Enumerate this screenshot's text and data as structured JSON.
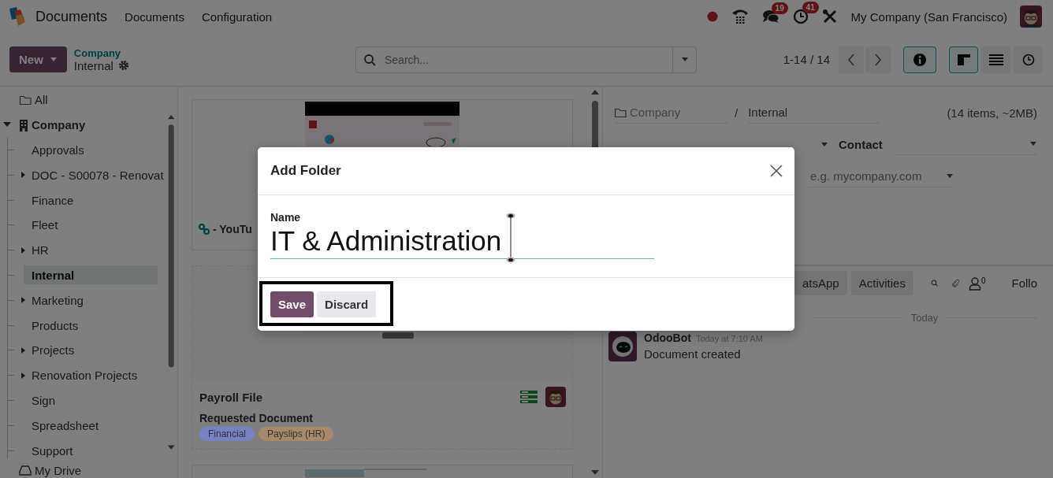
{
  "navbar": {
    "app_name": "Documents",
    "menu": [
      {
        "label": "Documents"
      },
      {
        "label": "Configuration"
      }
    ],
    "systray": [
      {
        "kind": "recording-dot"
      },
      {
        "kind": "phone"
      },
      {
        "kind": "chat",
        "badge": "19"
      },
      {
        "kind": "activity",
        "badge": "41"
      },
      {
        "kind": "tools"
      }
    ],
    "company": "My Company (San Francisco)"
  },
  "control_panel": {
    "new_button": "New",
    "breadcrumb": {
      "parent": "Company",
      "current": "Internal"
    },
    "search": {
      "placeholder": "Search..."
    },
    "pager": "1-14 / 14",
    "info_button": {
      "selected": true
    },
    "views": [
      {
        "kind": "kanban",
        "selected": true
      },
      {
        "kind": "list",
        "selected": false
      },
      {
        "kind": "activity",
        "selected": false
      }
    ]
  },
  "sidebar": {
    "items": [
      {
        "label": "All",
        "kind": "all",
        "selected": false
      },
      {
        "label": "Company",
        "kind": "company",
        "selected": false,
        "expanded": true,
        "children": [
          {
            "label": "Approvals",
            "expandable": false,
            "selected": false
          },
          {
            "label": "DOC - S00078 - Renovat",
            "expandable": true,
            "selected": false
          },
          {
            "label": "Finance",
            "expandable": false,
            "selected": false
          },
          {
            "label": "Fleet",
            "expandable": false,
            "selected": false
          },
          {
            "label": "HR",
            "expandable": true,
            "selected": false
          },
          {
            "label": "Internal",
            "expandable": false,
            "selected": true
          },
          {
            "label": "Marketing",
            "expandable": true,
            "selected": false
          },
          {
            "label": "Products",
            "expandable": false,
            "selected": false
          },
          {
            "label": "Projects",
            "expandable": true,
            "selected": false
          },
          {
            "label": "Renovation Projects",
            "expandable": true,
            "selected": false
          },
          {
            "label": "Sign",
            "expandable": false,
            "selected": false
          },
          {
            "label": "Spreadsheet",
            "expandable": false,
            "selected": false
          },
          {
            "label": "Support",
            "expandable": false,
            "selected": false
          }
        ]
      },
      {
        "label": "My Drive",
        "kind": "drive",
        "selected": false
      }
    ]
  },
  "kanban": {
    "cards": [
      {
        "kind": "link",
        "title": "- YouTu"
      },
      {
        "kind": "request",
        "title": "Payroll File",
        "subtitle": "Requested Document",
        "tags": [
          {
            "label": "Financial",
            "color": "#7582c4"
          },
          {
            "label": "Payslips (HR)",
            "color": "#a88a6a"
          }
        ]
      },
      {
        "kind": "sheet"
      }
    ]
  },
  "details": {
    "folder_path": {
      "parent": "Company",
      "separator": "/",
      "current": "Internal"
    },
    "summary": "(14 items, ~2MB)",
    "contact_label": "Contact",
    "domain": {
      "placeholder": "e.g. mycompany.com"
    },
    "chatter": {
      "buttons": [
        {
          "label": "atsApp"
        },
        {
          "label": "Activities"
        }
      ],
      "followers_count": "0",
      "follow_label": "Follo",
      "date_separator": "Today",
      "messages": [
        {
          "author": "OdooBot",
          "time": "Today at 7:10 AM",
          "body": "Document created"
        }
      ]
    }
  },
  "dialog": {
    "title": "Add Folder",
    "field_label": "Name",
    "value": "IT & Administration",
    "buttons": [
      {
        "label": "Save",
        "kind": "primary"
      },
      {
        "label": "Discard",
        "kind": "secondary"
      }
    ],
    "annotation_frame": true
  }
}
